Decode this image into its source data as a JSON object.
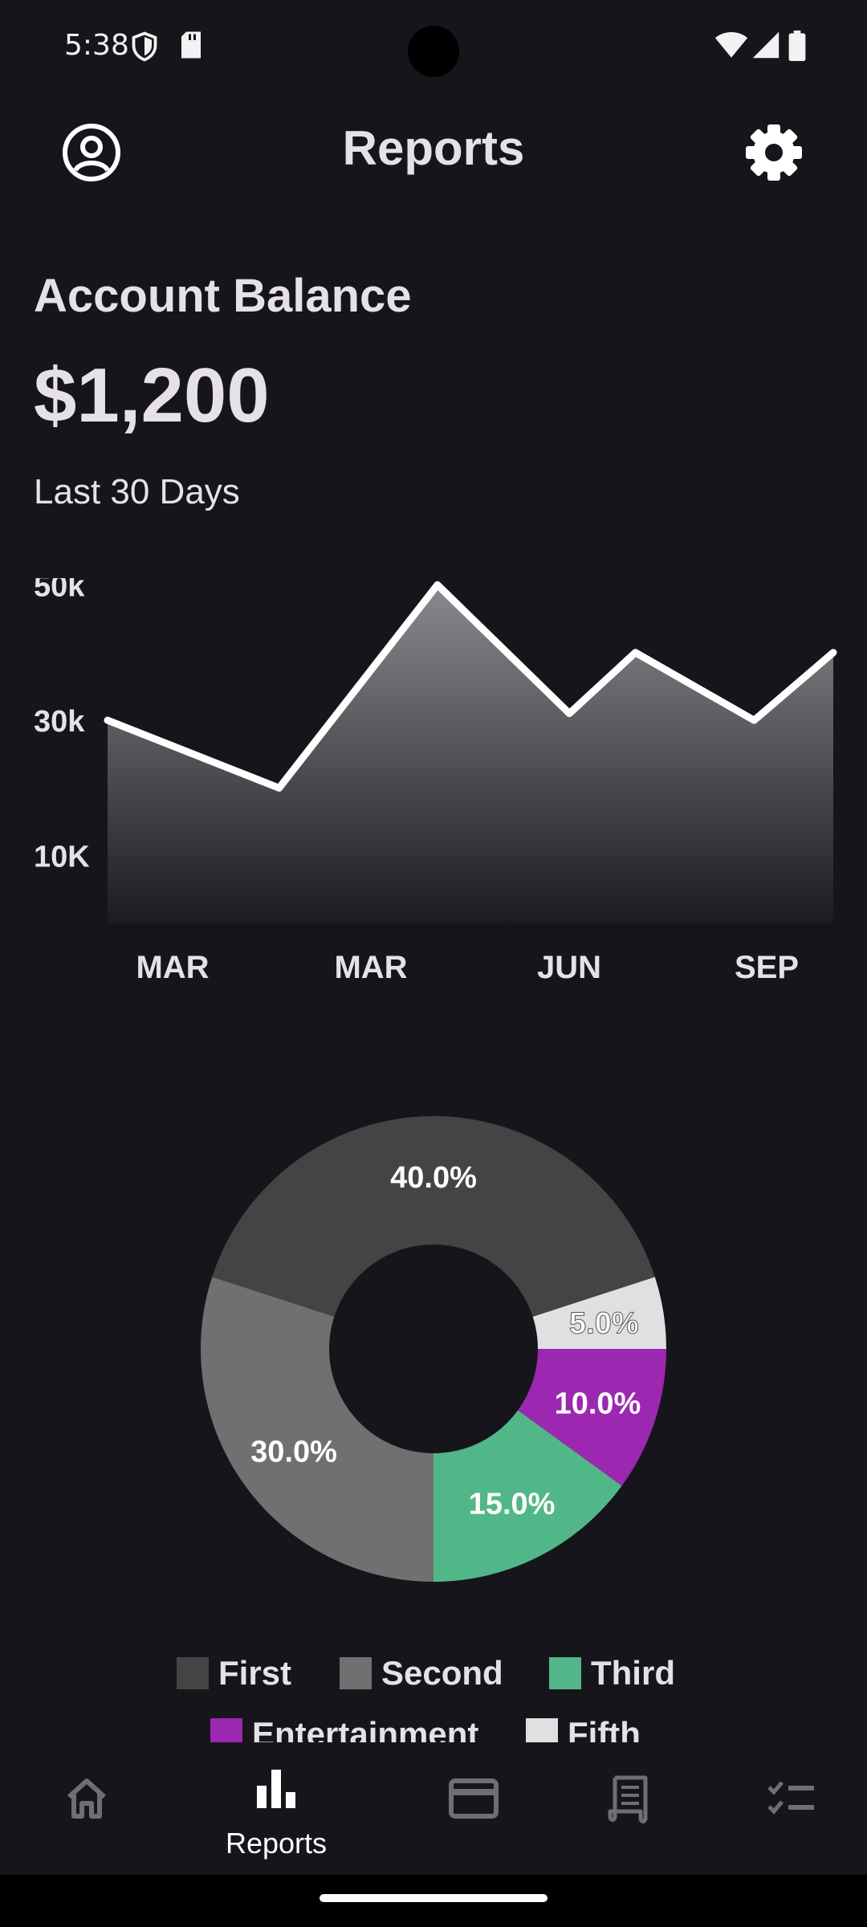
{
  "status_bar": {
    "time": "5:38",
    "icons": [
      "shield-icon",
      "sd-card-icon",
      "wifi-icon",
      "cellular-icon",
      "battery-icon"
    ]
  },
  "header": {
    "title": "Reports",
    "left_icon": "account-circle-icon",
    "right_icon": "gear-icon"
  },
  "balance": {
    "label": "Account Balance",
    "value": "$1,200",
    "period": "Last 30 Days"
  },
  "colors": {
    "background": "#16151b",
    "text": "#e6e1e8",
    "line": "#ffffff",
    "first": "#444444",
    "second": "#707070",
    "third": "#52b788",
    "entertainment": "#9c27b0",
    "fifth": "#e0e0e0"
  },
  "chart_data": [
    {
      "type": "area",
      "y_tick_labels": [
        "50k",
        "30k",
        "10K"
      ],
      "y_ticks": [
        50000,
        30000,
        10000
      ],
      "x_tick_labels": [
        "MAR",
        "MAR",
        "JUN",
        "SEP"
      ],
      "ylim": [
        0,
        51000
      ],
      "points": [
        {
          "x": 0,
          "y": 30000
        },
        {
          "x": 2.6,
          "y": 20000
        },
        {
          "x": 5,
          "y": 50000
        },
        {
          "x": 7,
          "y": 31000
        },
        {
          "x": 8,
          "y": 40000
        },
        {
          "x": 9.8,
          "y": 30000
        },
        {
          "x": 11,
          "y": 40000
        }
      ],
      "xlim": [
        0,
        11
      ],
      "grid": false
    },
    {
      "type": "pie",
      "donut": true,
      "slices": [
        {
          "label": "Fifth",
          "value": 5.0,
          "display": "5.0%",
          "color": "#e0e0e0"
        },
        {
          "label": "First",
          "value": 40.0,
          "display": "40.0%",
          "color": "#444444"
        },
        {
          "label": "Second",
          "value": 30.0,
          "display": "30.0%",
          "color": "#707070"
        },
        {
          "label": "Third",
          "value": 15.0,
          "display": "15.0%",
          "color": "#52b788"
        },
        {
          "label": "Entertainment",
          "value": 10.0,
          "display": "10.0%",
          "color": "#9c27b0"
        }
      ],
      "legend": [
        {
          "label": "First",
          "color": "#444444"
        },
        {
          "label": "Second",
          "color": "#707070"
        },
        {
          "label": "Third",
          "color": "#52b788"
        },
        {
          "label": "Entertainment",
          "color": "#9c27b0"
        },
        {
          "label": "Fifth",
          "color": "#e0e0e0"
        }
      ]
    }
  ],
  "bottom_nav": {
    "items": [
      {
        "icon": "home-icon",
        "label": ""
      },
      {
        "icon": "bar-chart-icon",
        "label": "Reports"
      },
      {
        "icon": "credit-card-icon",
        "label": ""
      },
      {
        "icon": "receipt-icon",
        "label": ""
      },
      {
        "icon": "checklist-icon",
        "label": ""
      }
    ]
  }
}
